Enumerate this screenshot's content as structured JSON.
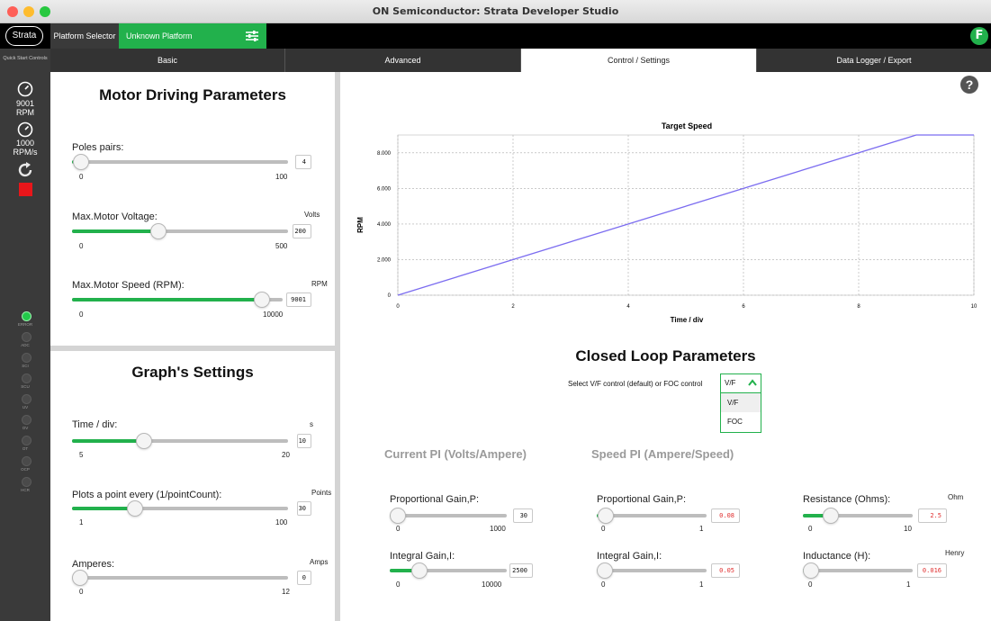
{
  "window": {
    "title": "ON Semiconductor: Strata Developer Studio"
  },
  "topbar": {
    "logo_text": "Strata",
    "platform_selector_label": "Platform Selector",
    "platform_name": "Unknown Platform",
    "user_initial": "F"
  },
  "sidebar": {
    "quick_start": "Quick Start Controls",
    "rpm_value": "9001",
    "rpm_unit": "RPM",
    "accel_value": "1000",
    "accel_unit": "RPM/s",
    "leds": [
      {
        "label": "ERROR",
        "active": true
      },
      {
        "label": "ADC",
        "active": false
      },
      {
        "label": "SCI",
        "active": false
      },
      {
        "label": "SCU",
        "active": false
      },
      {
        "label": "UV",
        "active": false
      },
      {
        "label": "OV",
        "active": false
      },
      {
        "label": "OT",
        "active": false
      },
      {
        "label": "OCP",
        "active": false
      },
      {
        "label": "HCR",
        "active": false
      }
    ]
  },
  "tabs": [
    "Basic",
    "Advanced",
    "Control / Settings",
    "Data Logger / Export"
  ],
  "active_tab": "Control / Settings",
  "motor": {
    "title": "Motor Driving Parameters",
    "poles": {
      "label": "Poles pairs:",
      "min": "0",
      "max": "100",
      "value": "4",
      "fraction": 0.04
    },
    "voltage": {
      "label": "Max.Motor Voltage:",
      "unit": "Volts",
      "min": "0",
      "max": "500",
      "value": "200",
      "fraction": 0.4
    },
    "speed": {
      "label": "Max.Motor Speed (RPM):",
      "unit": "RPM",
      "min": "0",
      "max": "10000",
      "value": "9001",
      "fraction": 0.9
    }
  },
  "graph_settings": {
    "title": "Graph's Settings",
    "time_div": {
      "label": "Time / div:",
      "unit": "s",
      "min": "5",
      "max": "20",
      "value": "10",
      "fraction": 0.333
    },
    "plots": {
      "label": "Plots a point every (1/pointCount):",
      "unit": "Points",
      "min": "1",
      "max": "100",
      "value": "30",
      "fraction": 0.293
    },
    "amperes": {
      "label": "Amperes:",
      "unit": "Amps",
      "min": "0",
      "max": "12",
      "value": "0",
      "fraction": 0
    }
  },
  "chart_data": {
    "type": "line",
    "title": "Target Speed",
    "xlabel": "Time / div",
    "ylabel": "RPM",
    "xlim": [
      0,
      10
    ],
    "ylim": [
      0,
      9000
    ],
    "xticks": [
      "0",
      "2",
      "4",
      "6",
      "8",
      "10"
    ],
    "yticks": [
      "0",
      "2.000",
      "4.000",
      "6.000",
      "8.000"
    ],
    "grid": true,
    "series": [
      {
        "x": [
          0,
          9,
          10
        ],
        "y": [
          0,
          9001,
          9001
        ],
        "color": "#7b6cf0"
      }
    ]
  },
  "closed_loop": {
    "title": "Closed Loop Parameters",
    "select_label": "Select V/F control (default) or FOC control",
    "selected": "V/F",
    "options": [
      "V/F",
      "FOC"
    ]
  },
  "current_pi": {
    "title": "Current PI (Volts/Ampere)",
    "p": {
      "label": "Proportional Gain,P:",
      "min": "0",
      "max": "1000",
      "value": "30",
      "fraction": 0.03
    },
    "i": {
      "label": "Integral Gain,I:",
      "min": "0",
      "max": "10000",
      "value": "2500",
      "fraction": 0.25
    }
  },
  "speed_pi": {
    "title": "Speed PI (Ampere/Speed)",
    "p": {
      "label": "Proportional Gain,P:",
      "min": "0",
      "max": "1",
      "value": "0.08",
      "fraction": 0.08
    },
    "i": {
      "label": "Integral Gain,I:",
      "min": "0",
      "max": "1",
      "value": "0.05",
      "fraction": 0.05
    }
  },
  "motor_params": {
    "resistance": {
      "label": "Resistance (Ohms):",
      "unit": "Ohm",
      "min": "0",
      "max": "10",
      "value": "2.5",
      "fraction": 0.25
    },
    "inductance": {
      "label": "Inductance (H):",
      "unit": "Henry",
      "min": "0",
      "max": "1",
      "value": "0.016",
      "fraction": 0.016
    }
  },
  "colors": {
    "accent": "#22b14c",
    "sidebar": "#3a3a3a",
    "topbar": "#000000",
    "line": "#7b6cf0",
    "warning_text": "#e03030"
  }
}
